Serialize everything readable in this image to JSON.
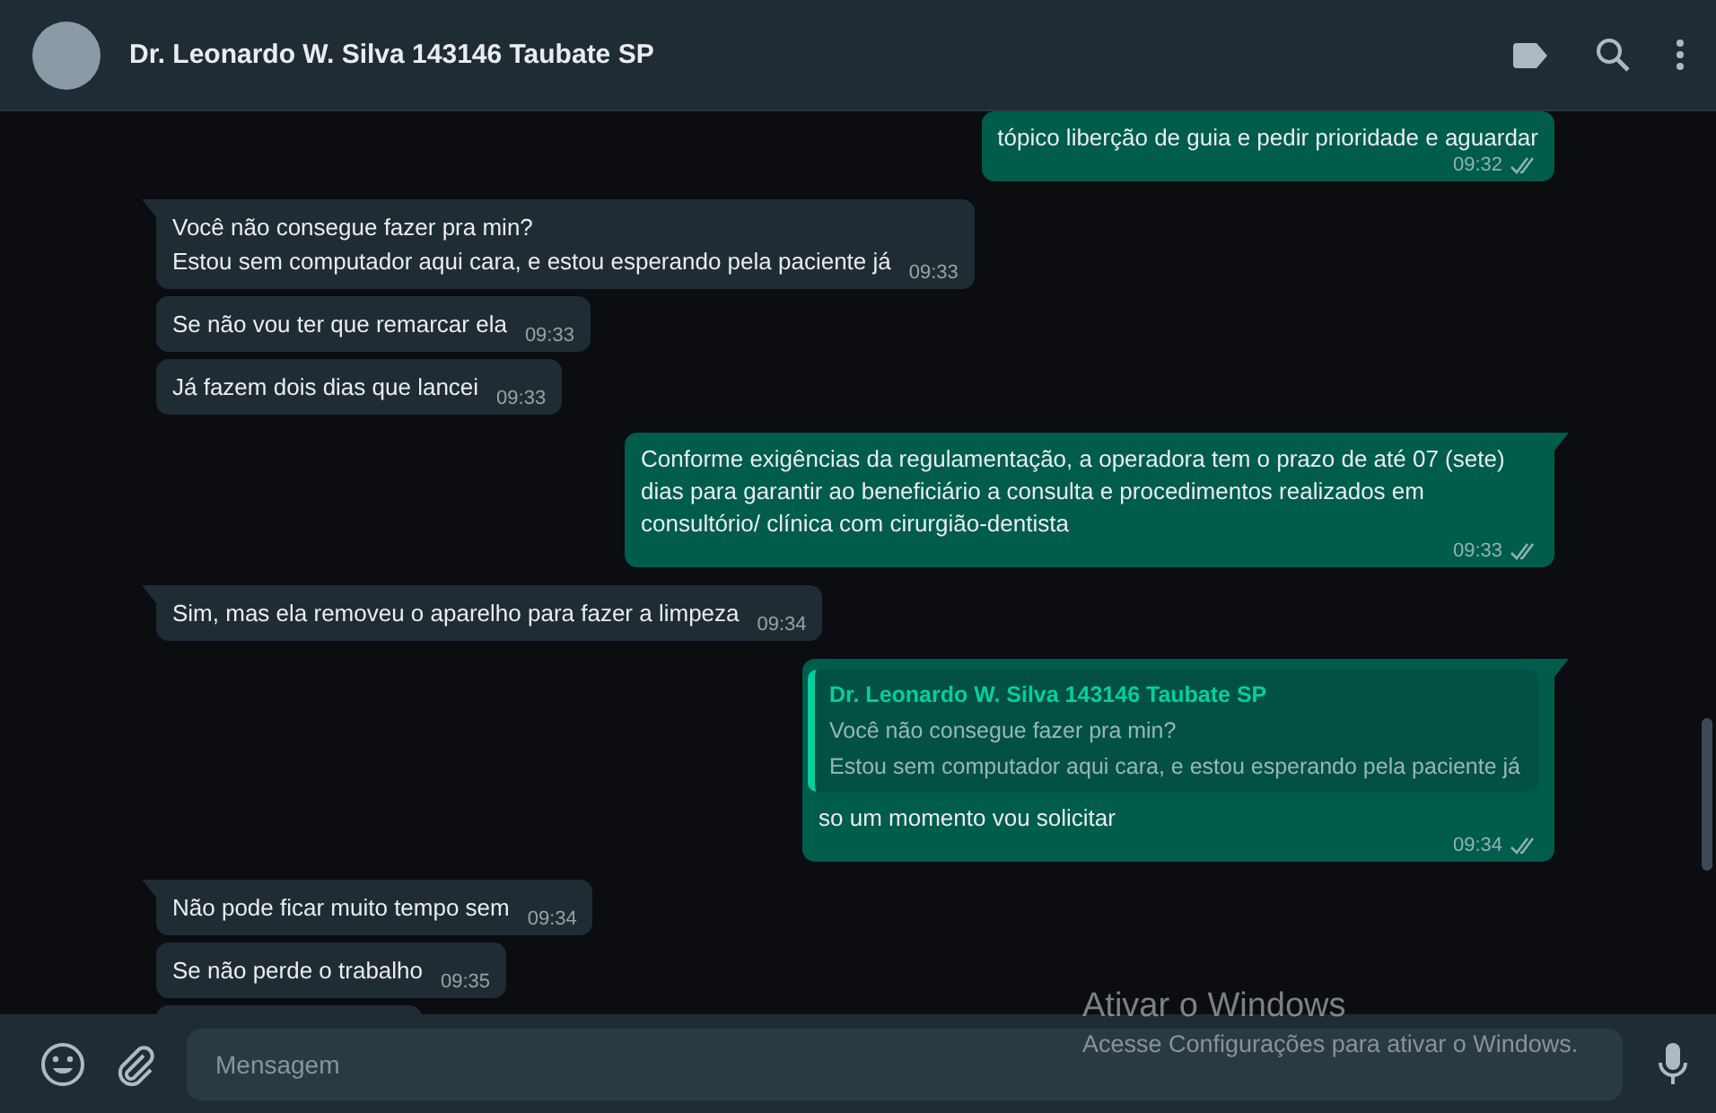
{
  "header": {
    "contact_name": "Dr. Leonardo W. Silva 143146 Taubate SP"
  },
  "messages": [
    {
      "kind": "out",
      "tail": false,
      "text": "tópico liberção de guia e pedir prioridade e aguardar",
      "time": "09:32",
      "read": false
    },
    {
      "kind": "in",
      "tail": true,
      "text": "Você não consegue fazer pra min?\nEstou sem computador aqui cara, e estou esperando pela paciente já",
      "time": "09:33"
    },
    {
      "kind": "in",
      "tail": false,
      "text": "Se não vou ter que remarcar ela",
      "time": "09:33"
    },
    {
      "kind": "in",
      "tail": false,
      "text": "Já fazem dois dias que lancei",
      "time": "09:33"
    },
    {
      "kind": "out",
      "tail": true,
      "text": "Conforme exigências da regulamentação, a operadora tem o prazo de até 07 (sete) dias para garantir ao beneficiário a consulta e procedimentos realizados em consultório/ clínica com cirurgião-dentista",
      "time": "09:33",
      "read": false
    },
    {
      "kind": "in",
      "tail": true,
      "text": "Sim, mas ela removeu o aparelho para fazer a limpeza",
      "time": "09:34"
    },
    {
      "kind": "out",
      "tail": true,
      "reply": {
        "author": "Dr. Leonardo W. Silva 143146 Taubate SP",
        "text": "Você não consegue fazer pra min?\nEstou sem computador aqui cara, e estou esperando pela paciente já"
      },
      "text": "so um momento vou solicitar",
      "time": "09:34",
      "read": false
    },
    {
      "kind": "in",
      "tail": true,
      "text": "Não pode ficar muito tempo sem",
      "time": "09:34"
    },
    {
      "kind": "in",
      "tail": false,
      "text": "Se não perde o trabalho",
      "time": "09:35"
    },
    {
      "kind": "stub",
      "tail": false
    }
  ],
  "composer": {
    "placeholder": "Mensagem"
  },
  "os_notice": {
    "title": "Ativar o Windows",
    "text": "Acesse Configurações para ativar o Windows."
  }
}
